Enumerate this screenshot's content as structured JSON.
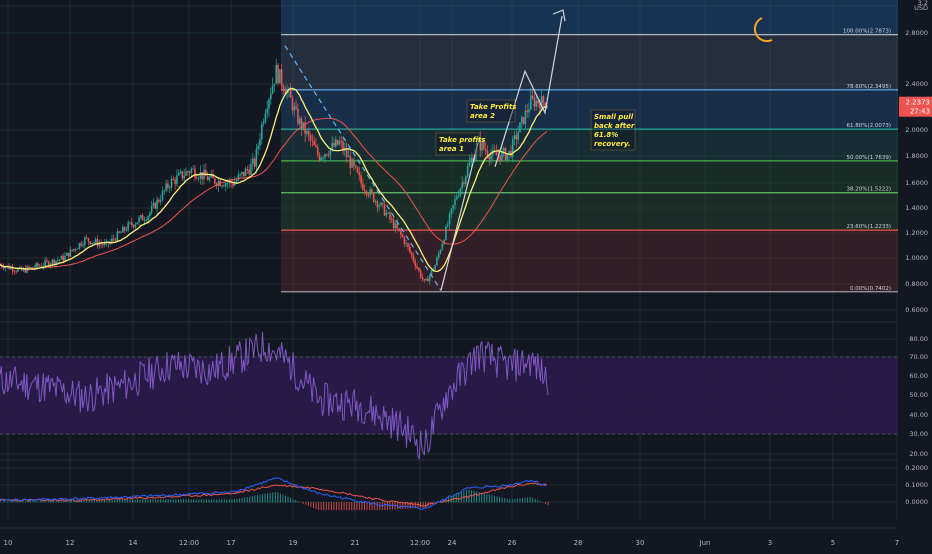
{
  "header": {
    "currency": "USD",
    "top_tick": "3.2"
  },
  "price_badge": {
    "price": "2.2373",
    "countdown": "27:43",
    "color": "#ef5350"
  },
  "annotations": {
    "tp2": [
      "Take Profits",
      "area 2"
    ],
    "tp1": [
      "Take profits",
      "area 1"
    ],
    "pullback": [
      "Small pull",
      "back after",
      "61.8%",
      "recovery."
    ]
  },
  "colors": {
    "background": "#131722",
    "grid": "#1d3a2b",
    "grid_alt": "#2a6a3f",
    "candle_up": "#26a69a",
    "candle_down": "#ef5350",
    "ma_fast": "#fff176",
    "ma_slow": "#ef5350",
    "rsi": "#7e57c2",
    "rsi_band": "#2a1b4a",
    "macd": "#2962ff",
    "signal": "#ef5350",
    "label_text": "#b2b5be",
    "fib_blue": "#2962ff",
    "fib_red": "#ef5350",
    "fib_green": "#4caf50",
    "moon": "#f5a623"
  },
  "chart_data": [
    {
      "type": "candlestick",
      "panel": "price",
      "x_tick_labels": [
        "10",
        "12",
        "14",
        "12:00",
        "17",
        "19",
        "21",
        "12:00",
        "24",
        "26",
        "28",
        "30",
        "Jun",
        "3",
        "5",
        "7"
      ],
      "y_tick_labels": [
        "3.2",
        "2.8000",
        "2.4000",
        "2.0000",
        "1.8000",
        "1.6000",
        "1.4000",
        "1.2000",
        "1.0000",
        "0.8000",
        "0.6000"
      ],
      "ylim": [
        0.6,
        3.2
      ],
      "y_scale": "log",
      "approx_close_path": [
        [
          0,
          0.95
        ],
        [
          10,
          0.9
        ],
        [
          20,
          0.95
        ],
        [
          30,
          1.0
        ],
        [
          40,
          1.15
        ],
        [
          50,
          1.1
        ],
        [
          60,
          1.25
        ],
        [
          70,
          1.35
        ],
        [
          80,
          1.6
        ],
        [
          90,
          1.7
        ],
        [
          100,
          1.62
        ],
        [
          110,
          1.6
        ],
        [
          120,
          1.75
        ],
        [
          125,
          2.2
        ],
        [
          130,
          2.5
        ],
        [
          135,
          2.35
        ],
        [
          140,
          2.1
        ],
        [
          150,
          1.8
        ],
        [
          160,
          1.9
        ],
        [
          170,
          1.6
        ],
        [
          180,
          1.4
        ],
        [
          190,
          1.15
        ],
        [
          200,
          0.8
        ],
        [
          205,
          0.95
        ],
        [
          215,
          1.5
        ],
        [
          225,
          1.9
        ],
        [
          232,
          1.8
        ],
        [
          240,
          1.82
        ],
        [
          250,
          2.25
        ],
        [
          258,
          2.24
        ]
      ],
      "fib_levels": [
        {
          "ratio": "100.00%",
          "price": "2.7873"
        },
        {
          "ratio": "78.60%",
          "price": "2.3495"
        },
        {
          "ratio": "61.80%",
          "price": "2.0073"
        },
        {
          "ratio": "50.00%",
          "price": "1.7639"
        },
        {
          "ratio": "38.20%",
          "price": "1.5222"
        },
        {
          "ratio": "23.60%",
          "price": "1.2233"
        },
        {
          "ratio": "0.00%",
          "price": "0.7402"
        }
      ],
      "last_price": "2.2373",
      "countdown": "27:43"
    },
    {
      "type": "line",
      "panel": "rsi",
      "y_tick_labels": [
        "80.00",
        "70.00",
        "60.00",
        "50.00",
        "40.00",
        "30.00",
        "20.00"
      ],
      "ylim": [
        14,
        86
      ],
      "levels": [
        70,
        30
      ],
      "x": [
        0,
        20,
        40,
        60,
        80,
        100,
        125,
        135,
        150,
        170,
        190,
        200,
        210,
        225,
        240,
        250,
        258
      ],
      "values": [
        58,
        55,
        49,
        56,
        66,
        63,
        76,
        68,
        48,
        45,
        33,
        23,
        50,
        72,
        65,
        68,
        58
      ]
    },
    {
      "type": "line",
      "panel": "macd",
      "y_tick_labels": [
        "0.2000",
        "0.1000",
        "0.0000"
      ],
      "ylim": [
        -0.06,
        0.22
      ],
      "series": [
        {
          "name": "",
          "x": [
            0,
            40,
            80,
            110,
            130,
            150,
            180,
            200,
            220,
            240,
            250,
            258
          ],
          "values": [
            0.01,
            0.02,
            0.04,
            0.06,
            0.14,
            0.05,
            -0.02,
            -0.04,
            0.08,
            0.1,
            0.13,
            0.09
          ]
        },
        {
          "name": "",
          "x": [
            0,
            40,
            80,
            110,
            130,
            150,
            180,
            200,
            220,
            240,
            250,
            258
          ],
          "values": [
            0.01,
            0.01,
            0.03,
            0.05,
            0.1,
            0.08,
            0.01,
            -0.02,
            0.03,
            0.09,
            0.11,
            0.1
          ]
        }
      ]
    }
  ]
}
